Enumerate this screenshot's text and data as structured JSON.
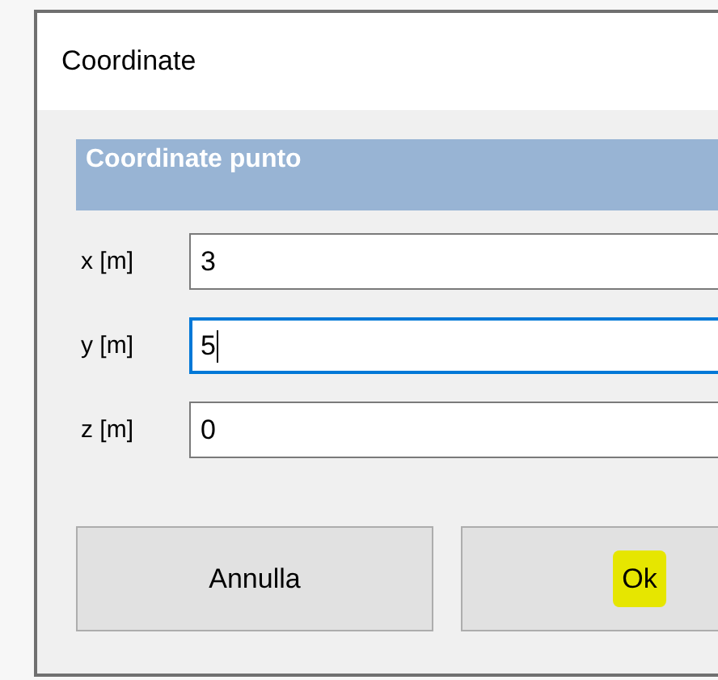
{
  "window": {
    "title": "Coordinate"
  },
  "group": {
    "title": "Coordinate punto"
  },
  "fields": [
    {
      "label": "x [m]",
      "value": "3",
      "focused": false
    },
    {
      "label": "y [m]",
      "value": "5",
      "focused": true
    },
    {
      "label": "z [m]",
      "value": "0",
      "focused": false
    }
  ],
  "buttons": [
    {
      "label": "Annulla",
      "highlighted": false
    },
    {
      "label": "Ok",
      "highlighted": true
    }
  ]
}
